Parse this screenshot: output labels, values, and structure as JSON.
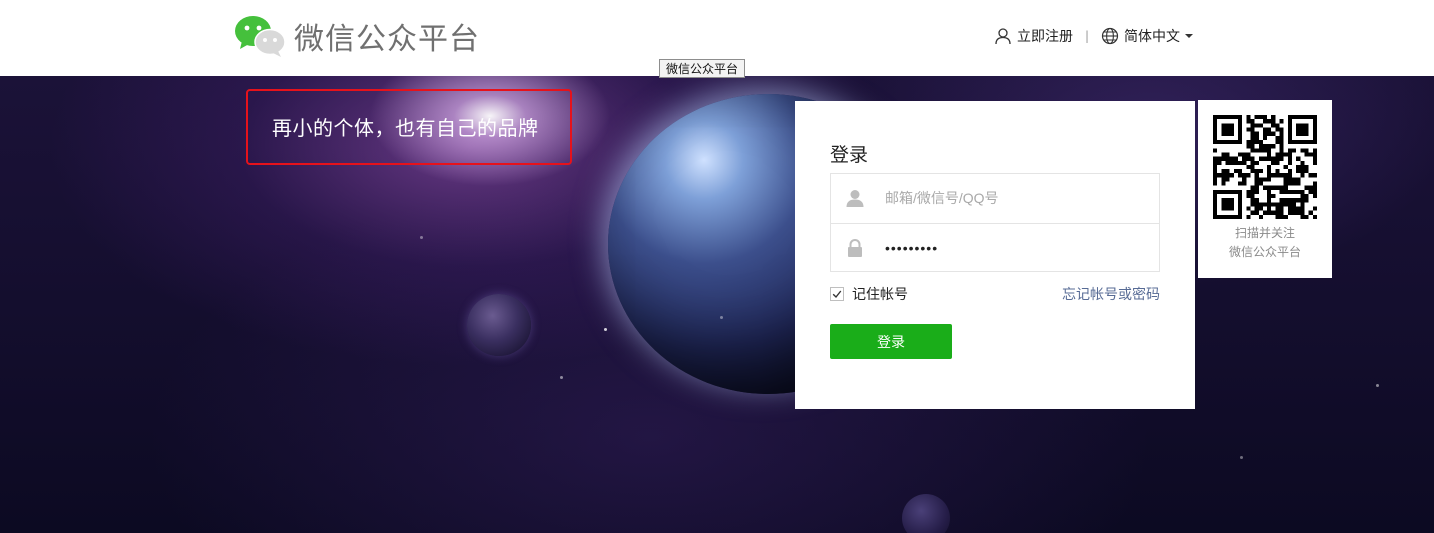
{
  "header": {
    "logo_text": "微信公众平台",
    "logo_icon": "wechat-logo-icon",
    "register_label": "立即注册",
    "register_icon": "user-icon",
    "separator": "|",
    "language_label": "简体中文",
    "language_icon": "globe-icon"
  },
  "tooltip": {
    "text": "微信公众平台"
  },
  "banner": {
    "slogan": "再小的个体，也有自己的品牌"
  },
  "login": {
    "title": "登录",
    "account_placeholder": "邮箱/微信号/QQ号",
    "account_value": "",
    "account_icon": "user-icon",
    "password_value": "•••••••••",
    "password_icon": "lock-icon",
    "remember_label": "记住帐号",
    "remember_checked": true,
    "forgot_label": "忘记帐号或密码",
    "submit_label": "登录"
  },
  "qr": {
    "caption_line1": "扫描并关注",
    "caption_line2": "微信公众平台"
  },
  "colors": {
    "accent_green": "#1aad19",
    "link_blue": "#576b95",
    "highlight_red": "#e6121b"
  }
}
